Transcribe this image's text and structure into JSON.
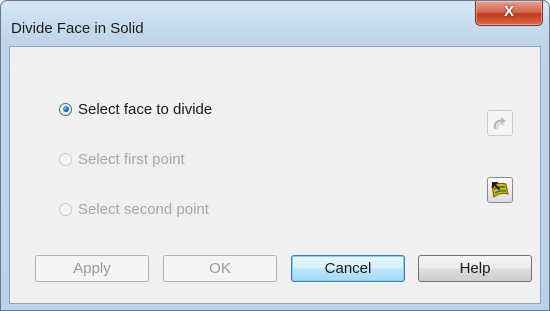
{
  "window": {
    "title": "Divide Face in Solid",
    "close_label": "X"
  },
  "radios": [
    {
      "label": "Select face to divide",
      "checked": true,
      "enabled": true
    },
    {
      "label": "Select first point",
      "checked": false,
      "enabled": false
    },
    {
      "label": "Select second point",
      "checked": false,
      "enabled": false
    }
  ],
  "side_buttons": [
    {
      "icon": "redo-arrow-icon",
      "enabled": false
    },
    {
      "icon": "surface-select-icon",
      "enabled": true
    }
  ],
  "buttons": {
    "apply": "Apply",
    "ok": "OK",
    "cancel": "Cancel",
    "help": "Help"
  }
}
